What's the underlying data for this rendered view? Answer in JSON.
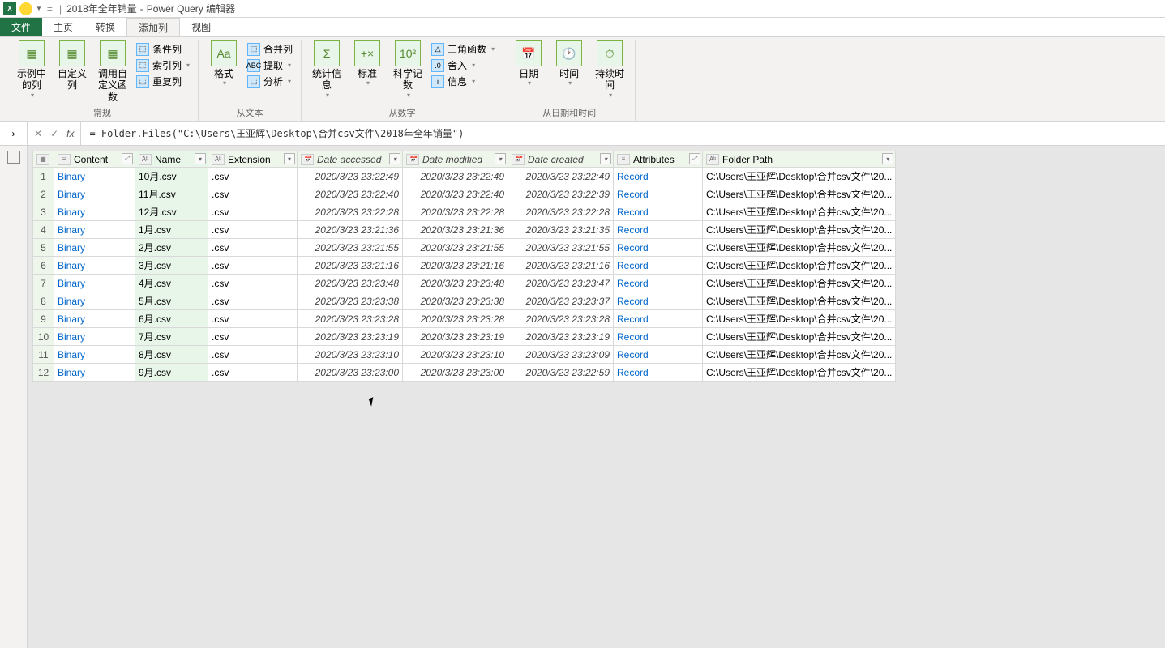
{
  "titlebar": {
    "doc_name": "2018年全年销量",
    "app_name": "Power Query 编辑器"
  },
  "tabs": {
    "file": "文件",
    "home": "主页",
    "transform": "转换",
    "add_column": "添加列",
    "view": "视图"
  },
  "ribbon": {
    "general": {
      "label": "常规",
      "from_examples": "示例中的列",
      "custom_col": "自定义列",
      "invoke": "调用自定义函数",
      "conditional": "条件列",
      "index": "索引列",
      "duplicate": "重复列"
    },
    "from_text": {
      "label": "从文本",
      "format": "格式",
      "merge": "合并列",
      "extract": "提取",
      "parse": "分析"
    },
    "from_number": {
      "label": "从数字",
      "stats": "统计信息",
      "standard": "标准",
      "scientific": "科学记数",
      "trig": "三角函数",
      "rounding": "舍入",
      "info": "信息"
    },
    "from_datetime": {
      "label": "从日期和时间",
      "date": "日期",
      "time": "时间",
      "duration": "持续时间"
    }
  },
  "formula": "= Folder.Files(\"C:\\Users\\王亚辉\\Desktop\\合并csv文件\\2018年全年销量\")",
  "columns": {
    "content": "Content",
    "name": "Name",
    "extension": "Extension",
    "date_accessed": "Date accessed",
    "date_modified": "Date modified",
    "date_created": "Date created",
    "attributes": "Attributes",
    "folder_path": "Folder Path"
  },
  "rows": [
    {
      "content": "Binary",
      "name": "10月.csv",
      "ext": ".csv",
      "accessed": "2020/3/23 23:22:49",
      "modified": "2020/3/23 23:22:49",
      "created": "2020/3/23 23:22:49",
      "attr": "Record",
      "path": "C:\\Users\\王亚辉\\Desktop\\合并csv文件\\20..."
    },
    {
      "content": "Binary",
      "name": "11月.csv",
      "ext": ".csv",
      "accessed": "2020/3/23 23:22:40",
      "modified": "2020/3/23 23:22:40",
      "created": "2020/3/23 23:22:39",
      "attr": "Record",
      "path": "C:\\Users\\王亚辉\\Desktop\\合并csv文件\\20..."
    },
    {
      "content": "Binary",
      "name": "12月.csv",
      "ext": ".csv",
      "accessed": "2020/3/23 23:22:28",
      "modified": "2020/3/23 23:22:28",
      "created": "2020/3/23 23:22:28",
      "attr": "Record",
      "path": "C:\\Users\\王亚辉\\Desktop\\合并csv文件\\20..."
    },
    {
      "content": "Binary",
      "name": "1月.csv",
      "ext": ".csv",
      "accessed": "2020/3/23 23:21:36",
      "modified": "2020/3/23 23:21:36",
      "created": "2020/3/23 23:21:35",
      "attr": "Record",
      "path": "C:\\Users\\王亚辉\\Desktop\\合并csv文件\\20..."
    },
    {
      "content": "Binary",
      "name": "2月.csv",
      "ext": ".csv",
      "accessed": "2020/3/23 23:21:55",
      "modified": "2020/3/23 23:21:55",
      "created": "2020/3/23 23:21:55",
      "attr": "Record",
      "path": "C:\\Users\\王亚辉\\Desktop\\合并csv文件\\20..."
    },
    {
      "content": "Binary",
      "name": "3月.csv",
      "ext": ".csv",
      "accessed": "2020/3/23 23:21:16",
      "modified": "2020/3/23 23:21:16",
      "created": "2020/3/23 23:21:16",
      "attr": "Record",
      "path": "C:\\Users\\王亚辉\\Desktop\\合并csv文件\\20..."
    },
    {
      "content": "Binary",
      "name": "4月.csv",
      "ext": ".csv",
      "accessed": "2020/3/23 23:23:48",
      "modified": "2020/3/23 23:23:48",
      "created": "2020/3/23 23:23:47",
      "attr": "Record",
      "path": "C:\\Users\\王亚辉\\Desktop\\合并csv文件\\20..."
    },
    {
      "content": "Binary",
      "name": "5月.csv",
      "ext": ".csv",
      "accessed": "2020/3/23 23:23:38",
      "modified": "2020/3/23 23:23:38",
      "created": "2020/3/23 23:23:37",
      "attr": "Record",
      "path": "C:\\Users\\王亚辉\\Desktop\\合并csv文件\\20..."
    },
    {
      "content": "Binary",
      "name": "6月.csv",
      "ext": ".csv",
      "accessed": "2020/3/23 23:23:28",
      "modified": "2020/3/23 23:23:28",
      "created": "2020/3/23 23:23:28",
      "attr": "Record",
      "path": "C:\\Users\\王亚辉\\Desktop\\合并csv文件\\20..."
    },
    {
      "content": "Binary",
      "name": "7月.csv",
      "ext": ".csv",
      "accessed": "2020/3/23 23:23:19",
      "modified": "2020/3/23 23:23:19",
      "created": "2020/3/23 23:23:19",
      "attr": "Record",
      "path": "C:\\Users\\王亚辉\\Desktop\\合并csv文件\\20..."
    },
    {
      "content": "Binary",
      "name": "8月.csv",
      "ext": ".csv",
      "accessed": "2020/3/23 23:23:10",
      "modified": "2020/3/23 23:23:10",
      "created": "2020/3/23 23:23:09",
      "attr": "Record",
      "path": "C:\\Users\\王亚辉\\Desktop\\合并csv文件\\20..."
    },
    {
      "content": "Binary",
      "name": "9月.csv",
      "ext": ".csv",
      "accessed": "2020/3/23 23:23:00",
      "modified": "2020/3/23 23:23:00",
      "created": "2020/3/23 23:22:59",
      "attr": "Record",
      "path": "C:\\Users\\王亚辉\\Desktop\\合并csv文件\\20..."
    }
  ]
}
